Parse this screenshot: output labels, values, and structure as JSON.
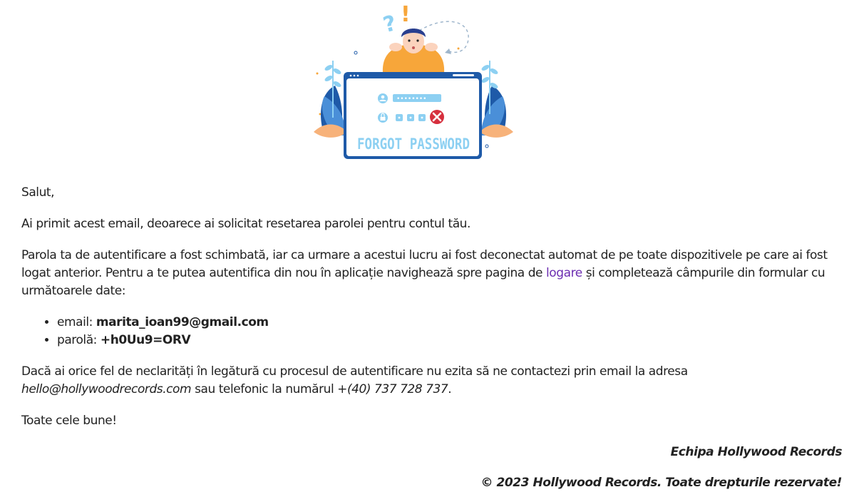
{
  "hero": {
    "caption": "FORGOT PASSWORD",
    "question_mark": "?",
    "exclamation_mark": "!",
    "colors": {
      "frame": "#1e5aa8",
      "accent": "#8dd0f2",
      "error": "#d62f3d",
      "shirt": "#f7a63a"
    }
  },
  "email": {
    "greeting": "Salut,",
    "intro": "Ai primit acest email, deoarece ai solicitat resetarea parolei pentru contul tău.",
    "body_before_link": "Parola ta de autentificare a fost schimbată, iar ca urmare a acestui lucru ai fost deconectat automat de pe toate dispozitivele pe care ai fost logat anterior. Pentru a te putea autentifica din nou în aplicație navighează spre pagina de ",
    "login_link": "logare",
    "body_after_link": " și completează câmpurile din formular cu următoarele date:",
    "credentials": {
      "email_label": "email: ",
      "email_value": "marita_ioan99@gmail.com",
      "password_label": "parolă: ",
      "password_value": "+h0Uu9=ORV"
    },
    "contact_before": "Dacă ai orice fel de neclarități în legătură cu procesul de autentificare nu ezita să ne contactezi prin email la adresa ",
    "contact_email": "hello@hollywoodrecords.com",
    "contact_middle": " sau telefonic la numărul ",
    "contact_phone": "+(40) 737 728 737",
    "contact_end": ".",
    "closing": "Toate cele bune!",
    "signature": "Echipa Hollywood Records",
    "footer": "© 2023 Hollywood Records. Toate drepturile rezervate!"
  }
}
